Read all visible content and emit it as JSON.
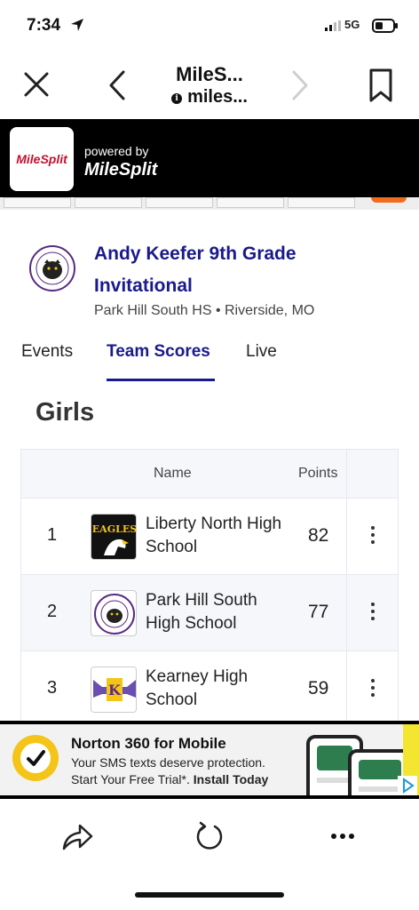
{
  "status": {
    "time": "7:34",
    "network": "5G"
  },
  "browser": {
    "title": "MileS...",
    "url": "miles..."
  },
  "banner": {
    "logo_text": "MileSplit",
    "powered_by": "powered by",
    "brand": "MileSplit"
  },
  "meet": {
    "title": "Andy Keefer 9th Grade Invitational",
    "location": "Park Hill South HS • Riverside, MO"
  },
  "tabs": [
    {
      "label": "Events"
    },
    {
      "label": "Team Scores"
    },
    {
      "label": "Live"
    }
  ],
  "section_title": "Girls",
  "table": {
    "headers": {
      "name": "Name",
      "points": "Points"
    },
    "rows": [
      {
        "rank": "1",
        "name": "Liberty North High School",
        "points": "82",
        "logo": "eagles-logo"
      },
      {
        "rank": "2",
        "name": "Park Hill South High School",
        "points": "77",
        "logo": "panthers-logo"
      },
      {
        "rank": "3",
        "name": "Kearney High School",
        "points": "59",
        "logo": "kearney-logo"
      }
    ]
  },
  "ad": {
    "headline": "Norton 360 for Mobile",
    "line1": "Your SMS texts deserve protection.",
    "line2_prefix": "Start Your Free Trial*.",
    "line2_cta": "Install Today"
  },
  "colors": {
    "accent": "#1a1a8c",
    "brand_red": "#c8102e",
    "ad_yellow": "#f4c518"
  }
}
